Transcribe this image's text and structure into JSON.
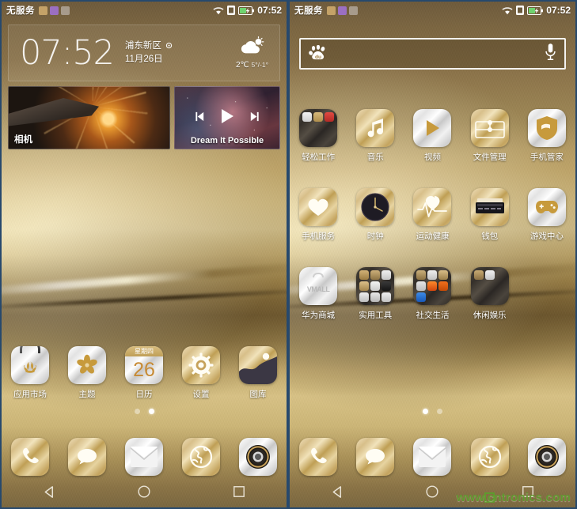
{
  "meta": {
    "watermark": "www.cntronics.com"
  },
  "status_bar": {
    "carrier": "无服务",
    "time": "07:52",
    "icons": [
      "notification-icon",
      "screenshot-icon",
      "input-method-icon",
      "wifi-icon",
      "sim-icon",
      "battery-charging-icon"
    ]
  },
  "left_screen": {
    "clock_widget": {
      "time": "07:52",
      "location": "浦东新区",
      "date": "11月26日",
      "temperature": "2℃",
      "temp_range": "5°/-1°",
      "weather_icon": "partly-cloudy-icon",
      "location_icon": "location-pin-icon"
    },
    "camera_widget": {
      "label": "相机"
    },
    "music_widget": {
      "title": "Dream It Possible",
      "controls": [
        "previous-icon",
        "play-icon",
        "next-icon"
      ]
    },
    "apps": [
      {
        "label": "应用市场",
        "icon": "appstore-icon",
        "style": "silver"
      },
      {
        "label": "主题",
        "icon": "themes-icon",
        "style": "silver"
      },
      {
        "label": "日历",
        "icon": "calendar-icon",
        "style": "silver",
        "day": "26",
        "weekday": "星期四"
      },
      {
        "label": "设置",
        "icon": "settings-gear-icon",
        "style": "gold"
      },
      {
        "label": "图库",
        "icon": "gallery-icon",
        "style": "gold"
      }
    ],
    "page_dots": {
      "count": 2,
      "active": 1
    }
  },
  "right_screen": {
    "search_widget": {
      "placeholder": "",
      "value": "",
      "brand_icon": "baidu-paw-icon",
      "voice_icon": "microphone-icon"
    },
    "apps": [
      {
        "label": "轻松工作",
        "icon": "folder-icon",
        "type": "folder",
        "items": 3
      },
      {
        "label": "音乐",
        "icon": "music-note-icon",
        "style": "gold"
      },
      {
        "label": "视频",
        "icon": "video-play-icon",
        "style": "silver"
      },
      {
        "label": "文件管理",
        "icon": "file-manager-icon",
        "style": "gold"
      },
      {
        "label": "手机管家",
        "icon": "shield-icon",
        "style": "silver"
      },
      {
        "label": "手机服务",
        "icon": "heart-service-icon",
        "style": "gold"
      },
      {
        "label": "时钟",
        "icon": "analog-clock-icon",
        "style": "gold"
      },
      {
        "label": "运动健康",
        "icon": "health-pulse-icon",
        "style": "gold"
      },
      {
        "label": "钱包",
        "icon": "wallet-card-icon",
        "style": "gold"
      },
      {
        "label": "游戏中心",
        "icon": "gamepad-icon",
        "style": "silver"
      },
      {
        "label": "华为商城",
        "icon": "vmall-icon",
        "style": "silver",
        "text": "VMALL"
      },
      {
        "label": "实用工具",
        "icon": "folder-icon",
        "type": "folder",
        "items": 9
      },
      {
        "label": "社交生活",
        "icon": "folder-icon",
        "type": "folder",
        "items": 7
      },
      {
        "label": "休闲娱乐",
        "icon": "folder-icon",
        "type": "folder",
        "items": 2
      }
    ],
    "page_dots": {
      "count": 2,
      "active": 0
    }
  },
  "dock": [
    {
      "label": "phone",
      "icon": "phone-icon",
      "style": "gold"
    },
    {
      "label": "messages",
      "icon": "message-icon",
      "style": "gold"
    },
    {
      "label": "email",
      "icon": "envelope-icon",
      "style": "silver"
    },
    {
      "label": "browser",
      "icon": "globe-icon",
      "style": "gold"
    },
    {
      "label": "camera",
      "icon": "camera-lens-icon",
      "style": "silver"
    }
  ],
  "nav_bar": [
    {
      "icon": "back-icon"
    },
    {
      "icon": "home-icon"
    },
    {
      "icon": "recents-icon"
    }
  ],
  "colors": {
    "gold": "#c9a65d",
    "dark_gold": "#6e5a3b",
    "accent_white": "#ffffff",
    "watermark_green": "#5f9b2e"
  }
}
